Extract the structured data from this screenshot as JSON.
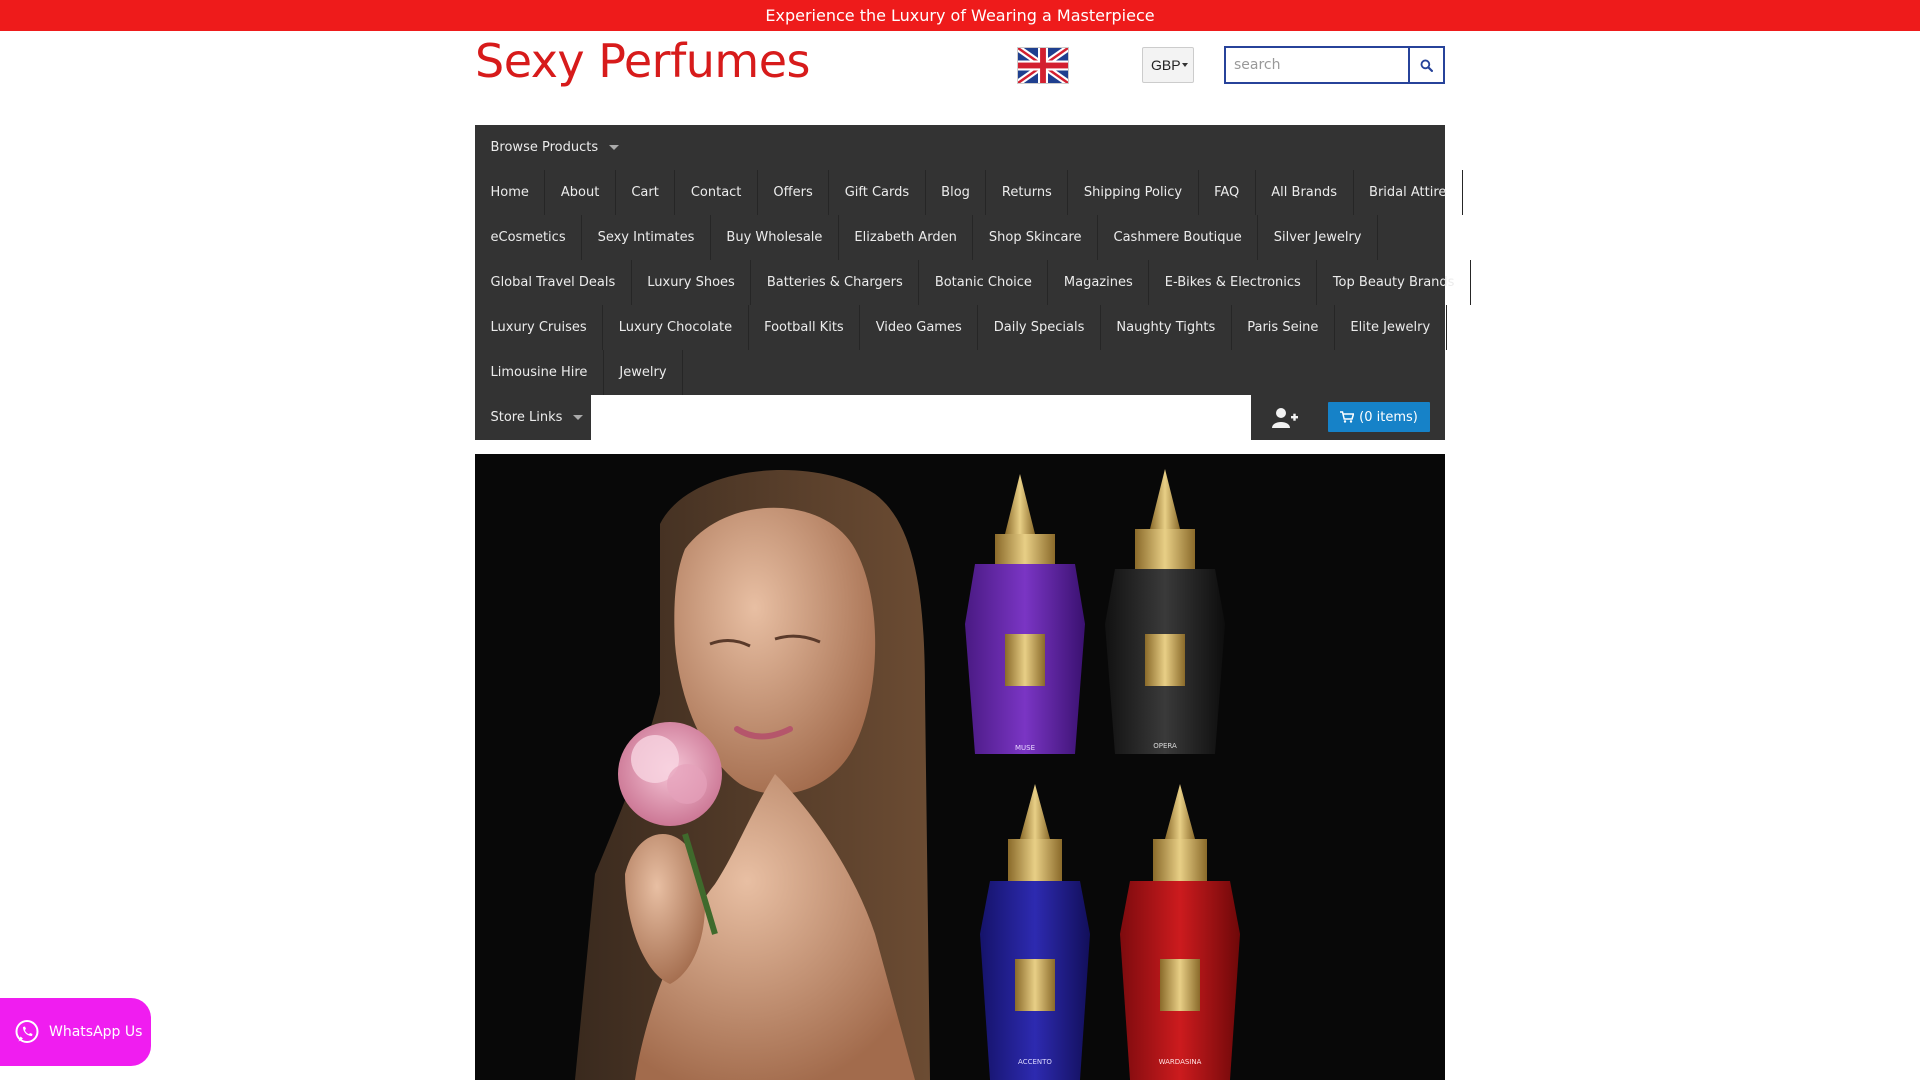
{
  "promo": {
    "text": "Experience the Luxury of Wearing a Masterpiece"
  },
  "header": {
    "logo": "Sexy Perfumes",
    "currency": "GBP",
    "search_placeholder": "search"
  },
  "nav": {
    "browse_label": "Browse Products",
    "rows": [
      [
        "Home",
        "About",
        "Cart",
        "Contact",
        "Offers",
        "Gift Cards",
        "Blog",
        "Returns",
        "Shipping Policy",
        "FAQ",
        "All Brands",
        "Bridal Attire"
      ],
      [
        "eCosmetics",
        "Sexy Intimates",
        "Buy Wholesale",
        "Elizabeth Arden",
        "Shop Skincare",
        "Cashmere Boutique",
        "Silver Jewelry"
      ],
      [
        "Global Travel Deals",
        "Luxury Shoes",
        "Batteries & Chargers",
        "Botanic Choice",
        "Magazines",
        "E-Bikes & Electronics",
        "Top Beauty Brands"
      ],
      [
        "Luxury Cruises",
        "Luxury Chocolate",
        "Football Kits",
        "Video Games",
        "Daily Specials",
        "Naughty Tights",
        "Paris Seine",
        "Elite Jewelry"
      ],
      [
        "Limousine Hire",
        "Jewelry"
      ]
    ],
    "store_links_label": "Store Links",
    "cart_label": "(0 items)"
  },
  "hero": {
    "bottle_labels": [
      "MUSE",
      "OPERA",
      "ACCENTO",
      "WARDASINA"
    ]
  },
  "whatsapp": {
    "label": "WhatsApp Us"
  },
  "colors": {
    "promo_bg": "#ee1b1b",
    "logo": "#d71b1b",
    "nav_bg": "#333333",
    "cart_btn": "#1682c8",
    "whatsapp_bg": "#f01df0",
    "search_border": "#27439a"
  },
  "icons": {
    "search": "search-icon",
    "cart": "cart-icon",
    "user_add": "user-plus-icon",
    "whatsapp": "whatsapp-icon",
    "flag": "uk-flag-icon"
  }
}
